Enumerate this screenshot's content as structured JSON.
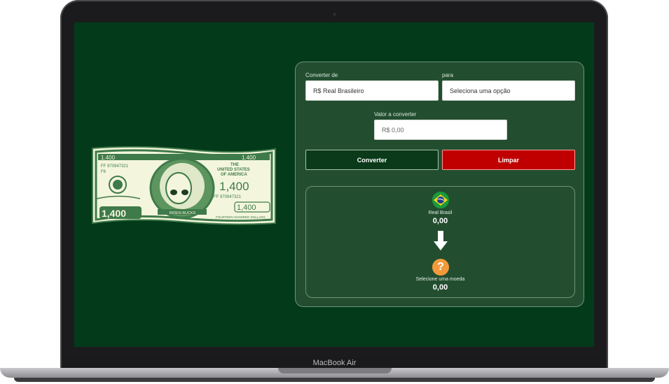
{
  "device": {
    "model_label": "MacBook Air"
  },
  "converter": {
    "from_label": "Converter de",
    "from_value": "R$ Real Brasileiro",
    "to_label": "para",
    "to_value": "Seleciona uma opção",
    "amount_label": "Valor a converter",
    "amount_placeholder": "R$ 0,00",
    "convert_button": "Converter",
    "clear_button": "Limpar"
  },
  "result": {
    "from_currency": "Real Brasil",
    "from_amount": "0,00",
    "to_currency": "Selecione uma moeda",
    "to_amount": "0,00",
    "unknown_symbol": "?"
  },
  "bill": {
    "denomination": "1.400",
    "serial": "FF 970947321",
    "plate": "F6",
    "country_line1": "THE",
    "country_line2": "UNITED STATES",
    "country_line3": "OF AMERICA",
    "amount": "1,400",
    "amount_left": "1,400",
    "name": "BIDEN BUCKS",
    "words": "FOURTEEN HUNDRED DOLLARS"
  },
  "colors": {
    "background": "#033a1a",
    "panel": "#224e2f",
    "clear": "#c00000",
    "convert": "#0a3a19",
    "bill_green": "#3f7a4a"
  }
}
